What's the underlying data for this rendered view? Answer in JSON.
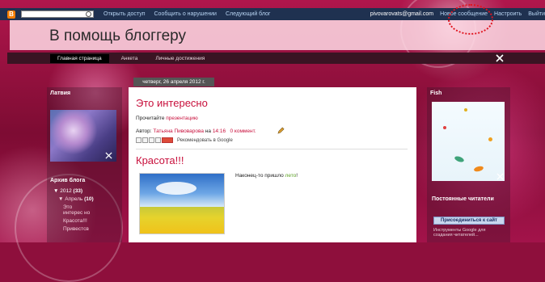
{
  "navbar": {
    "logo": "B",
    "search_placeholder": "",
    "links": [
      "Открыть доступ",
      "Сообщить о нарушении",
      "Следующий блог"
    ],
    "user_email": "pivovarovats@gmail.com",
    "right_links": [
      "Новое сообщение",
      "Настроить",
      "Выйти"
    ]
  },
  "header": {
    "title": "В помощь блоггеру"
  },
  "tabs": [
    "Главная страница",
    "Анкета",
    "Личные достижения"
  ],
  "left_sidebar": {
    "profile_title": "Латвия",
    "archive_title": "Архив блога",
    "archive": {
      "year": "2012",
      "year_count": "(33)",
      "month": "Апрель",
      "month_count": "(10)",
      "posts": [
        "Это интерес но",
        "Красота!!!",
        "Привестсв"
      ]
    }
  },
  "date_header": "четверг, 26 апреля 2012 г.",
  "post1": {
    "title": "Это интересно",
    "read_prefix": "Прочитайте",
    "read_link": "презентацию",
    "author_label": "Автор:",
    "author": "Татьяна Пивоварова",
    "at_label": "на",
    "time": "14:16",
    "comments": "0 коммент.",
    "share_text": "Рекомендовать в Google"
  },
  "post2": {
    "title": "Красота!!!",
    "text_prefix": "Наконец-то пришло",
    "text_link": "лето",
    "text_suffix": "!"
  },
  "right_sidebar": {
    "fish_title": "Fish",
    "followers_title": "Постоянные читатели",
    "join_button": "Присоединиться к сайт",
    "followers_note": "Инструменты Google для создания читателей..."
  },
  "colors": {
    "navbar_bg": "#1f3150",
    "accent_red": "#c8103c",
    "header_bg": "#ffdce6"
  }
}
